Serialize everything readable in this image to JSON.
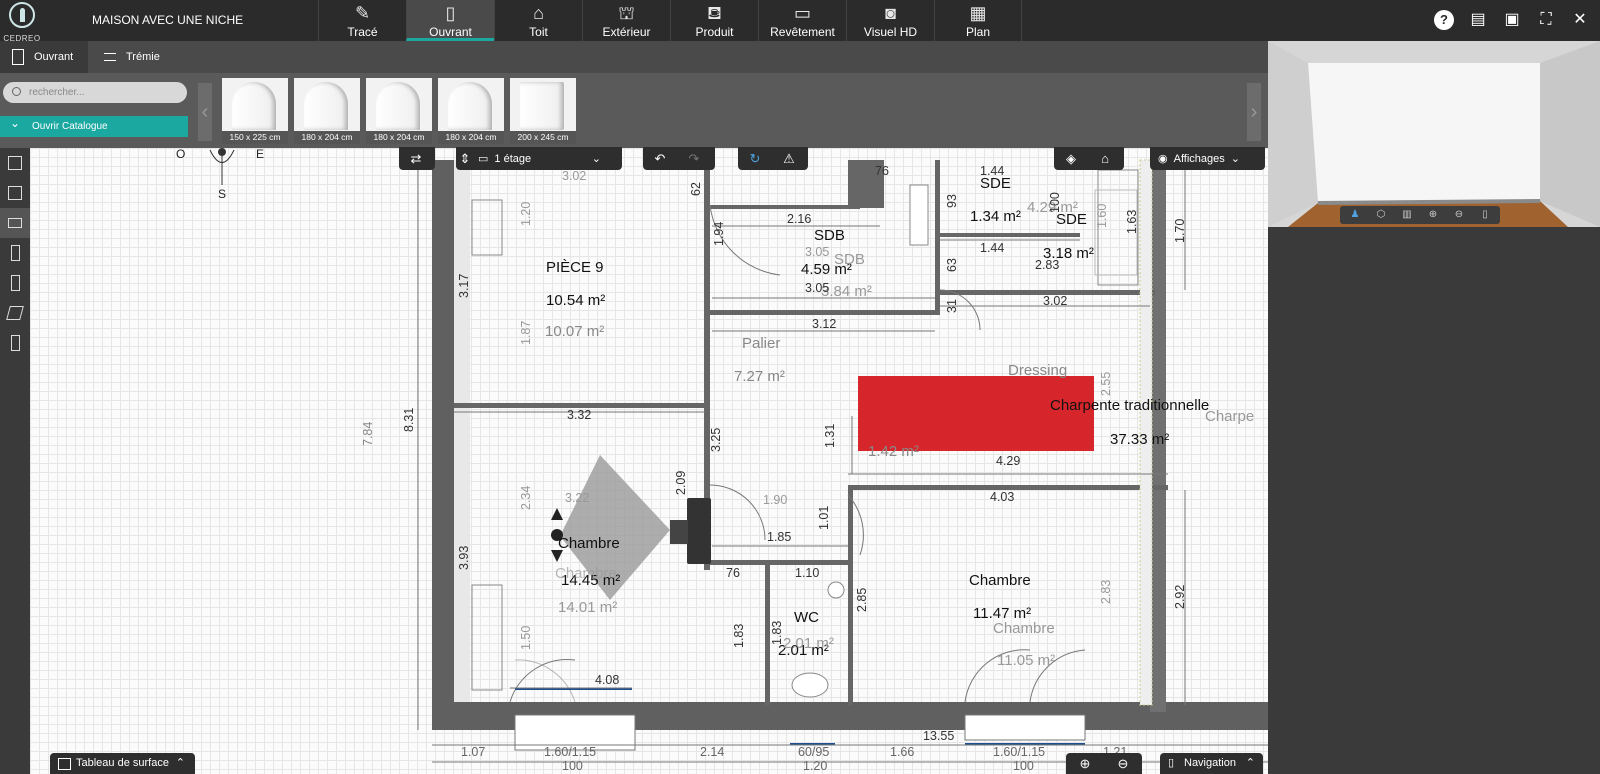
{
  "app": {
    "logo_text": "CEDREO",
    "project_title": "MAISON AVEC UNE NICHE"
  },
  "tabs": [
    {
      "label": "Tracé",
      "icon": "pencil-icon"
    },
    {
      "label": "Ouvrant",
      "icon": "door-icon",
      "active": true
    },
    {
      "label": "Toit",
      "icon": "roof-icon"
    },
    {
      "label": "Extérieur",
      "icon": "house-exterior-icon"
    },
    {
      "label": "Produit",
      "icon": "furniture-icon"
    },
    {
      "label": "Revêtement",
      "icon": "paint-roller-icon"
    },
    {
      "label": "Visuel HD",
      "icon": "camera-icon"
    },
    {
      "label": "Plan",
      "icon": "blueprint-icon"
    }
  ],
  "top_icons": [
    "help-icon",
    "comment-icon",
    "save-icon",
    "fullscreen-icon",
    "close-icon"
  ],
  "subtabs": {
    "ouvrant": "Ouvrant",
    "tremie": "Trémie"
  },
  "catalog": {
    "search_placeholder": "rechercher...",
    "open_catalog": "Ouvrir Catalogue",
    "items": [
      {
        "caption": "150 x 225 cm"
      },
      {
        "caption": "180 x 204 cm"
      },
      {
        "caption": "180 x 204 cm"
      },
      {
        "caption": "180 x 204 cm"
      },
      {
        "caption": "200 x 245 cm"
      }
    ]
  },
  "toolbar": {
    "floor": "1 étage",
    "affichages": "Affichages"
  },
  "compass": {
    "w": "O",
    "e": "E",
    "s": "S"
  },
  "rooms": {
    "piece9": {
      "name": "PIÈCE 9",
      "area1": "10.54 m²",
      "area2": "10.07 m²",
      "w": "3.22"
    },
    "sdb": {
      "name": "SDB",
      "area": "4.59 m²",
      "ghost_name": "SDB",
      "ghost_area": "3.84 m²"
    },
    "sde1": {
      "name": "SDE",
      "area": "1.34 m²"
    },
    "sde2": {
      "name": "SDE",
      "area": "3.18 m²",
      "ghost_area": "4.29 m²"
    },
    "palier": {
      "name": "Palier",
      "area": "7.27 m²"
    },
    "dressing": {
      "name": "Dressing",
      "area": "1.42 m²"
    },
    "charpente": {
      "name": "Charpente traditionnelle",
      "area": "37.33 m²",
      "ghost": "Charpe"
    },
    "chambre1": {
      "name": "Chambre",
      "area1": "14.45 m²",
      "ghost": "Chambre",
      "area2": "14.01 m²"
    },
    "chambre2": {
      "name": "Chambre",
      "area1": "11.47 m²",
      "ghost": "Chambre",
      "area2": "11.05 m²"
    },
    "wc": {
      "name": "WC",
      "area": "2.01 m²",
      "ghost_area": "2.01 m²"
    }
  },
  "dims": {
    "d_302top": "3.02",
    "d_216": "2.16",
    "d_305a": "3.05",
    "d_305b": "3.05",
    "d_312": "3.12",
    "d_144a": "1.44",
    "d_144b": "1.44",
    "d_283": "2.83",
    "d_302": "3.02",
    "d_76a": "76",
    "d_100": "100",
    "d_160": "1.60",
    "d_163": "1.63",
    "d_170": "1.70",
    "d_93": "93",
    "d_63": "63",
    "d_31": "31",
    "d_62": "62",
    "d_194": "1.94",
    "d_120": "1.20",
    "d_187": "1.87",
    "d_317": "3.17",
    "d_784": "7.84",
    "d_831": "8.31",
    "d_332": "3.32",
    "d_325": "3.25",
    "d_131": "1.31",
    "d_429": "4.29",
    "d_255": "2.55",
    "d_322b": "3.22",
    "d_234": "2.34",
    "d_209": "2.09",
    "d_190": "1.90",
    "d_403": "4.03",
    "d_101": "1.01",
    "d_185": "1.85",
    "d_393": "3.93",
    "d_76b": "76",
    "d_110": "1.10",
    "d_285": "2.85",
    "d_283b": "2.83",
    "d_292": "2.92",
    "d_183a": "1.83",
    "d_183b": "1.83",
    "d_150": "1.50",
    "d_408": "4.08",
    "d_1355": "13.55",
    "d_107": "1.07",
    "d_160115a": "1.60/1.15",
    "d_214": "2.14",
    "d_6095": "60/95",
    "d_166": "1.66",
    "d_160115b": "1.60/1.15",
    "d_121": "1.21",
    "d_100a": "100",
    "d_120b": "1.20",
    "d_100b": "100"
  },
  "viewer_controls": [
    "person-icon",
    "3d-view-icon",
    "bookshelf-icon",
    "zoom-in-icon",
    "zoom-out-icon",
    "mouse-icon"
  ],
  "bottom": {
    "surface_table": "Tableau de surface",
    "navigation": "Navigation"
  },
  "colors": {
    "accent": "#1aa8a0",
    "roof_block": "#d7262b",
    "topbar": "#2b2b2b"
  }
}
